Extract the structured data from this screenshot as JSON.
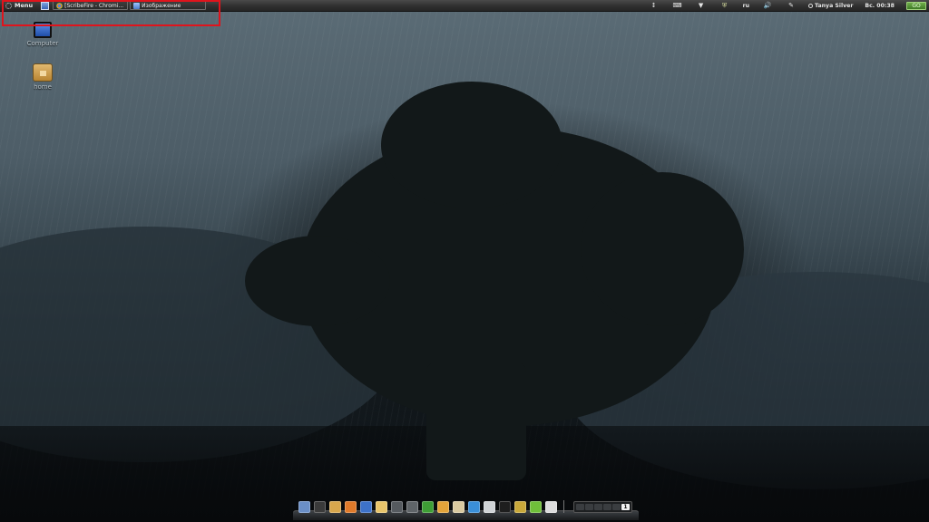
{
  "top_panel": {
    "menu_label": "Menu",
    "launcher_icon": "panel-launcher-icon",
    "tasks": [
      {
        "label": "[ScribeFire - Chromi...",
        "icon": "chromium-icon"
      },
      {
        "label": "Изображение",
        "icon": "image-viewer-icon"
      }
    ],
    "tray": {
      "icons": [
        "network-icon",
        "keyboard-icon",
        "download-icon",
        "shield-icon"
      ],
      "language": "ru",
      "volume_icon": "speaker-icon",
      "pen_icon": "pen-icon",
      "user_name": "Tanya Silver",
      "clock": "Вс. 00:38",
      "session_label": "GO"
    }
  },
  "desktop": {
    "icons": [
      {
        "label": "Computer",
        "icon": "computer-icon"
      },
      {
        "label": "home",
        "icon": "home-folder-icon"
      }
    ]
  },
  "dock": {
    "apps": [
      {
        "name": "dock-app-1",
        "color": "#6a8fc7"
      },
      {
        "name": "dock-app-2",
        "color": "#3a3a3a"
      },
      {
        "name": "dock-app-3",
        "color": "#d7a64d"
      },
      {
        "name": "dock-app-firefox",
        "color": "#e07a2a"
      },
      {
        "name": "dock-app-5",
        "color": "#3d72c9"
      },
      {
        "name": "dock-app-6",
        "color": "#e8c46a"
      },
      {
        "name": "dock-app-7",
        "color": "#555a5f"
      },
      {
        "name": "dock-app-8",
        "color": "#5f6468"
      },
      {
        "name": "dock-app-9",
        "color": "#3e9e35"
      },
      {
        "name": "dock-app-10",
        "color": "#e2a33a"
      },
      {
        "name": "dock-app-11",
        "color": "#d9c9a0"
      },
      {
        "name": "dock-app-12",
        "color": "#3a8fd8"
      },
      {
        "name": "dock-app-13",
        "color": "#cfd3d6"
      },
      {
        "name": "dock-app-terminal",
        "color": "#1e1e1e"
      },
      {
        "name": "dock-app-15",
        "color": "#c8a83a"
      },
      {
        "name": "dock-app-16",
        "color": "#6fbf3a"
      },
      {
        "name": "dock-app-17",
        "color": "#dcdcdc"
      }
    ],
    "workspace_active": "1"
  }
}
